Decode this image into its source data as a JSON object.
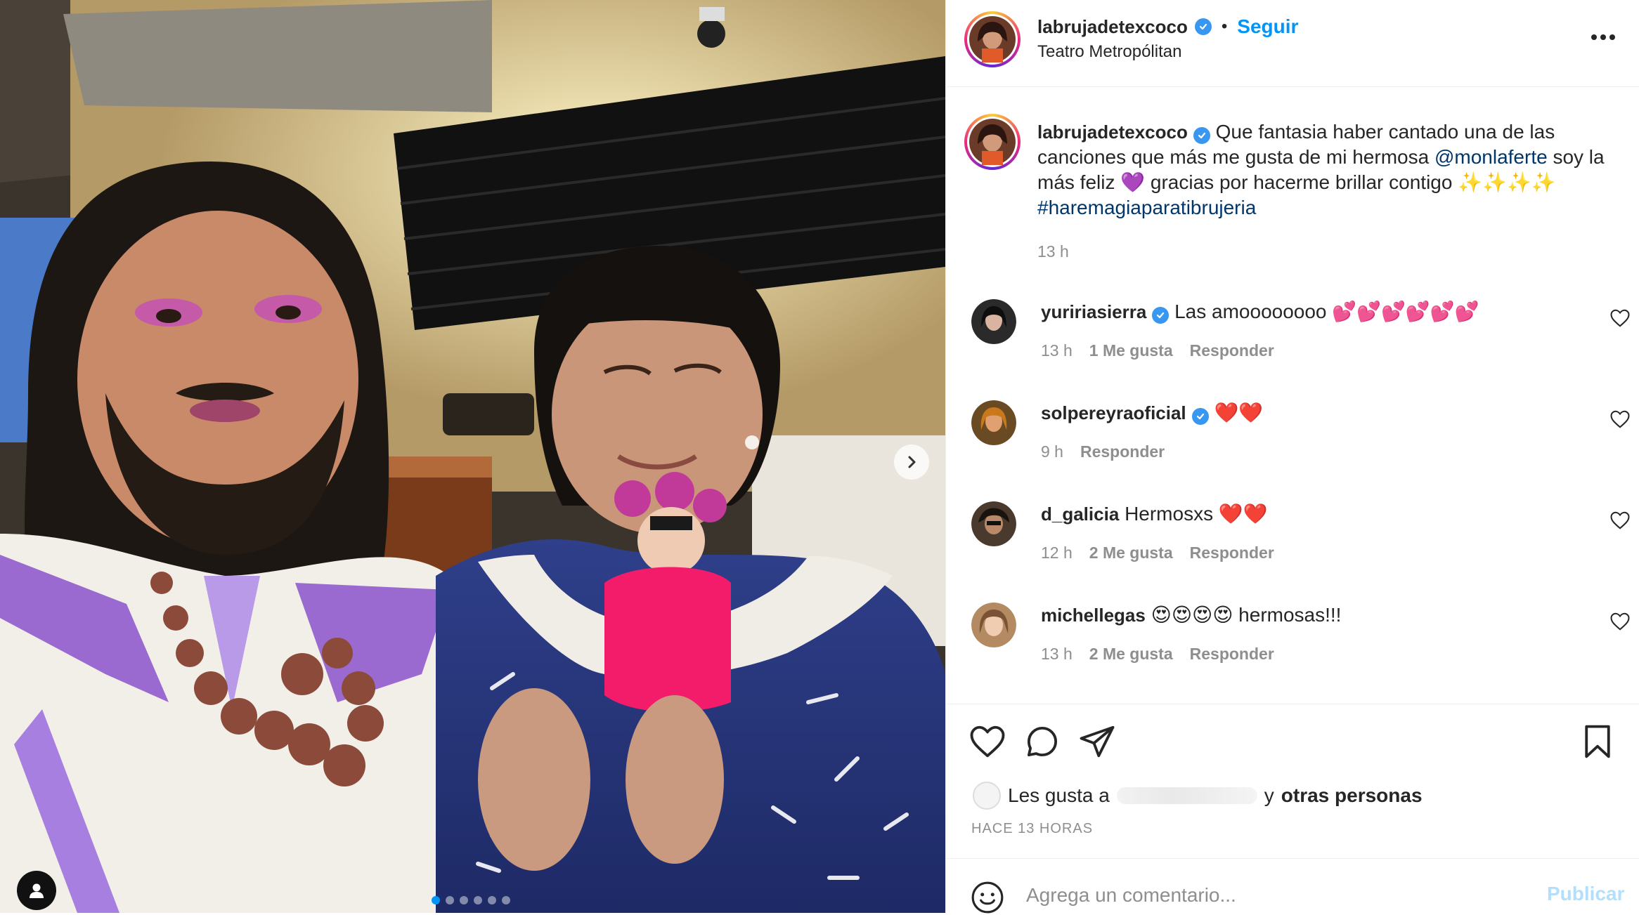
{
  "post": {
    "author": "labrujadetexcoco",
    "follow_label": "Seguir",
    "separator": "•",
    "location": "Teatro Metropólitan"
  },
  "caption": {
    "username": "labrujadetexcoco",
    "text_1": "Que fantasia haber cantado una de las canciones que más me gusta de mi hermosa ",
    "mention": "@monlaferte",
    "text_2": " soy la más feliz ",
    "emoji_1": "💜",
    "text_3": " gracias por hacerme brillar contigo ",
    "emoji_2": "✨✨✨✨",
    "hashtag": "#haremagiaparatibrujeria",
    "time": "13 h"
  },
  "comments": [
    {
      "username": "yuririasierra",
      "verified": true,
      "text": "Las amoooooooo 💕💕💕💕💕💕",
      "time": "13 h",
      "likes": "1 Me gusta",
      "reply": "Responder",
      "avatar_color": "#3a3a3a"
    },
    {
      "username": "solpereyraoficial",
      "verified": true,
      "text": "❤️❤️",
      "time": "9 h",
      "likes": "",
      "reply": "Responder",
      "avatar_color": "#8a5a2b"
    },
    {
      "username": "d_galicia",
      "verified": false,
      "text": "Hermosxs ❤️❤️",
      "time": "12 h",
      "likes": "2 Me gusta",
      "reply": "Responder",
      "avatar_color": "#5a4a3a"
    },
    {
      "username": "michellegas",
      "verified": false,
      "text": "😍😍😍😍 hermosas!!!",
      "time": "13 h",
      "likes": "2 Me gusta",
      "reply": "Responder",
      "avatar_color": "#c9a27a"
    }
  ],
  "likes": {
    "prefix": "Les gusta a",
    "suffix": "y",
    "others": "otras personas"
  },
  "posted": "HACE 13 HORAS",
  "comment_box": {
    "placeholder": "Agrega un comentario...",
    "publish_label": "Publicar"
  },
  "carousel": {
    "count": 6,
    "active": 0
  },
  "colors": {
    "accent": "#0095f6",
    "link": "#00376b",
    "muted": "#8e8e8e",
    "verified": "#3897f0"
  }
}
